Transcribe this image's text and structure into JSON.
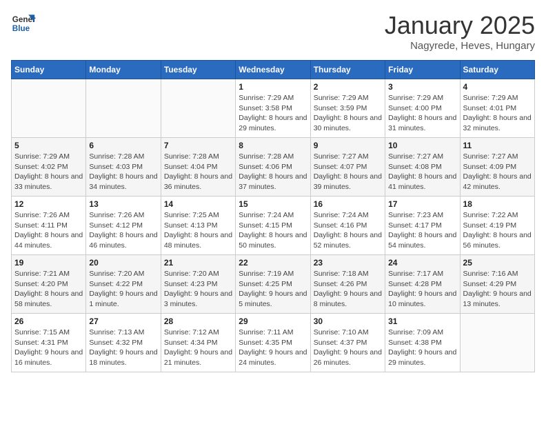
{
  "logo": {
    "line1": "General",
    "line2": "Blue"
  },
  "title": "January 2025",
  "location": "Nagyrede, Heves, Hungary",
  "weekdays": [
    "Sunday",
    "Monday",
    "Tuesday",
    "Wednesday",
    "Thursday",
    "Friday",
    "Saturday"
  ],
  "weeks": [
    [
      {
        "day": "",
        "info": ""
      },
      {
        "day": "",
        "info": ""
      },
      {
        "day": "",
        "info": ""
      },
      {
        "day": "1",
        "info": "Sunrise: 7:29 AM\nSunset: 3:58 PM\nDaylight: 8 hours and 29 minutes."
      },
      {
        "day": "2",
        "info": "Sunrise: 7:29 AM\nSunset: 3:59 PM\nDaylight: 8 hours and 30 minutes."
      },
      {
        "day": "3",
        "info": "Sunrise: 7:29 AM\nSunset: 4:00 PM\nDaylight: 8 hours and 31 minutes."
      },
      {
        "day": "4",
        "info": "Sunrise: 7:29 AM\nSunset: 4:01 PM\nDaylight: 8 hours and 32 minutes."
      }
    ],
    [
      {
        "day": "5",
        "info": "Sunrise: 7:29 AM\nSunset: 4:02 PM\nDaylight: 8 hours and 33 minutes."
      },
      {
        "day": "6",
        "info": "Sunrise: 7:28 AM\nSunset: 4:03 PM\nDaylight: 8 hours and 34 minutes."
      },
      {
        "day": "7",
        "info": "Sunrise: 7:28 AM\nSunset: 4:04 PM\nDaylight: 8 hours and 36 minutes."
      },
      {
        "day": "8",
        "info": "Sunrise: 7:28 AM\nSunset: 4:06 PM\nDaylight: 8 hours and 37 minutes."
      },
      {
        "day": "9",
        "info": "Sunrise: 7:27 AM\nSunset: 4:07 PM\nDaylight: 8 hours and 39 minutes."
      },
      {
        "day": "10",
        "info": "Sunrise: 7:27 AM\nSunset: 4:08 PM\nDaylight: 8 hours and 41 minutes."
      },
      {
        "day": "11",
        "info": "Sunrise: 7:27 AM\nSunset: 4:09 PM\nDaylight: 8 hours and 42 minutes."
      }
    ],
    [
      {
        "day": "12",
        "info": "Sunrise: 7:26 AM\nSunset: 4:11 PM\nDaylight: 8 hours and 44 minutes."
      },
      {
        "day": "13",
        "info": "Sunrise: 7:26 AM\nSunset: 4:12 PM\nDaylight: 8 hours and 46 minutes."
      },
      {
        "day": "14",
        "info": "Sunrise: 7:25 AM\nSunset: 4:13 PM\nDaylight: 8 hours and 48 minutes."
      },
      {
        "day": "15",
        "info": "Sunrise: 7:24 AM\nSunset: 4:15 PM\nDaylight: 8 hours and 50 minutes."
      },
      {
        "day": "16",
        "info": "Sunrise: 7:24 AM\nSunset: 4:16 PM\nDaylight: 8 hours and 52 minutes."
      },
      {
        "day": "17",
        "info": "Sunrise: 7:23 AM\nSunset: 4:17 PM\nDaylight: 8 hours and 54 minutes."
      },
      {
        "day": "18",
        "info": "Sunrise: 7:22 AM\nSunset: 4:19 PM\nDaylight: 8 hours and 56 minutes."
      }
    ],
    [
      {
        "day": "19",
        "info": "Sunrise: 7:21 AM\nSunset: 4:20 PM\nDaylight: 8 hours and 58 minutes."
      },
      {
        "day": "20",
        "info": "Sunrise: 7:20 AM\nSunset: 4:22 PM\nDaylight: 9 hours and 1 minute."
      },
      {
        "day": "21",
        "info": "Sunrise: 7:20 AM\nSunset: 4:23 PM\nDaylight: 9 hours and 3 minutes."
      },
      {
        "day": "22",
        "info": "Sunrise: 7:19 AM\nSunset: 4:25 PM\nDaylight: 9 hours and 5 minutes."
      },
      {
        "day": "23",
        "info": "Sunrise: 7:18 AM\nSunset: 4:26 PM\nDaylight: 9 hours and 8 minutes."
      },
      {
        "day": "24",
        "info": "Sunrise: 7:17 AM\nSunset: 4:28 PM\nDaylight: 9 hours and 10 minutes."
      },
      {
        "day": "25",
        "info": "Sunrise: 7:16 AM\nSunset: 4:29 PM\nDaylight: 9 hours and 13 minutes."
      }
    ],
    [
      {
        "day": "26",
        "info": "Sunrise: 7:15 AM\nSunset: 4:31 PM\nDaylight: 9 hours and 16 minutes."
      },
      {
        "day": "27",
        "info": "Sunrise: 7:13 AM\nSunset: 4:32 PM\nDaylight: 9 hours and 18 minutes."
      },
      {
        "day": "28",
        "info": "Sunrise: 7:12 AM\nSunset: 4:34 PM\nDaylight: 9 hours and 21 minutes."
      },
      {
        "day": "29",
        "info": "Sunrise: 7:11 AM\nSunset: 4:35 PM\nDaylight: 9 hours and 24 minutes."
      },
      {
        "day": "30",
        "info": "Sunrise: 7:10 AM\nSunset: 4:37 PM\nDaylight: 9 hours and 26 minutes."
      },
      {
        "day": "31",
        "info": "Sunrise: 7:09 AM\nSunset: 4:38 PM\nDaylight: 9 hours and 29 minutes."
      },
      {
        "day": "",
        "info": ""
      }
    ]
  ]
}
